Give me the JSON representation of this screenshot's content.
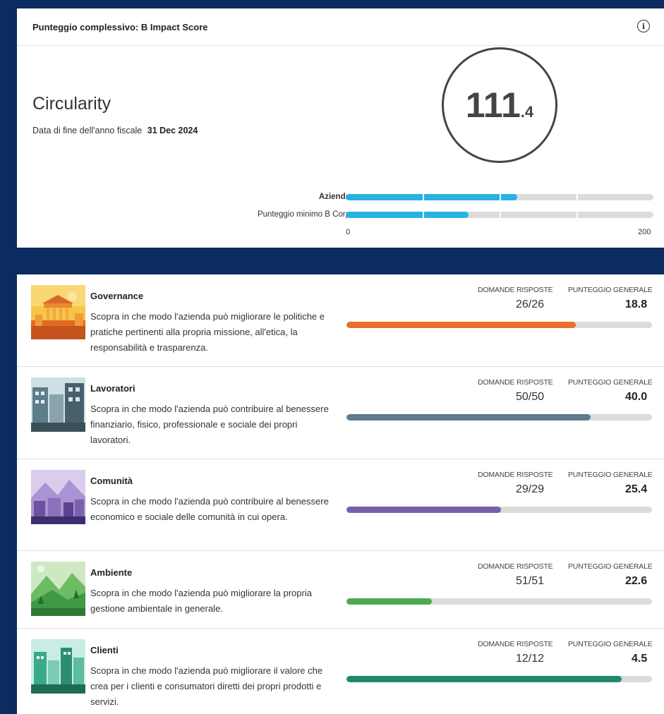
{
  "overall": {
    "header": "Punteggio complessivo: B Impact Score",
    "info_icon": "info-icon",
    "company": "Circularity",
    "fiscal_label": "Data di fine dell'anno fiscale",
    "fiscal_date": "31 Dec 2024",
    "score_int": "111",
    "score_dec": ".4",
    "score_value": 111.4,
    "comparison": {
      "company_label": "Azienda",
      "company_value": 111.4,
      "minimum_label": "Punteggio minimo B Corp",
      "minimum_value": 80,
      "axis_min": "0",
      "axis_max": "200",
      "max_value": 200,
      "bar_color": "#27b2e2"
    }
  },
  "stat_labels": {
    "questions": "DOMANDE RISPOSTE",
    "score": "PUNTEGGIO GENERALE"
  },
  "areas": [
    {
      "title": "Governance",
      "description": "Scopra in che modo l'azienda può migliorare le politiche e pratiche pertinenti alla propria missione, all'etica, la responsabilità e trasparenza.",
      "answered": "26/26",
      "score": "18.8",
      "progress": 0.75,
      "color": "#e8702a",
      "image": "governance-illustration"
    },
    {
      "title": "Lavoratori",
      "description": "Scopra in che modo l'azienda può contribuire al benessere finanziario, fisico, professionale e sociale dei propri lavoratori.",
      "answered": "50/50",
      "score": "40.0",
      "progress": 0.8,
      "color": "#5e7c8a",
      "image": "workers-illustration"
    },
    {
      "title": "Comunità",
      "description": "Scopra in che modo l'azienda può contribuire al benessere economico e sociale delle comunità in cui opera.",
      "answered": "29/29",
      "score": "25.4",
      "progress": 0.505,
      "color": "#7b5ea8",
      "image": "community-illustration"
    },
    {
      "title": "Ambiente",
      "description": "Scopra in che modo l'azienda può migliorare la propria gestione ambientale in generale.",
      "answered": "51/51",
      "score": "22.6",
      "progress": 0.28,
      "color": "#4caa55",
      "image": "environment-illustration"
    },
    {
      "title": "Clienti",
      "description": "Scopra in che modo l'azienda può migliorare il valore che crea per i clienti e consumatori diretti dei propri prodotti e servizi.",
      "answered": "12/12",
      "score": "4.5",
      "progress": 0.9,
      "color": "#1f8a6e",
      "image": "customers-illustration"
    }
  ]
}
